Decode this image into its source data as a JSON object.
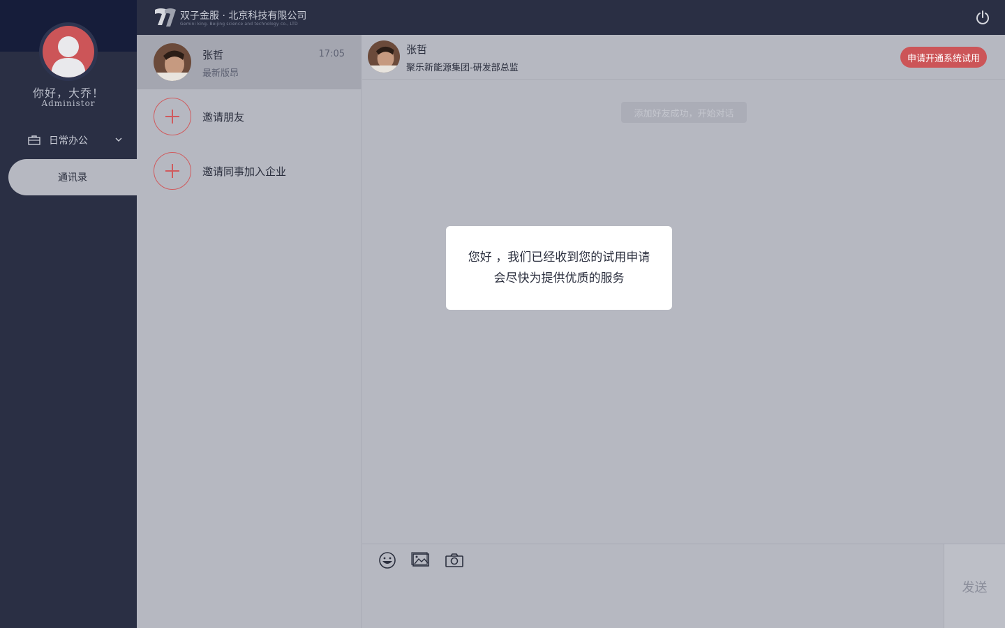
{
  "sidebar": {
    "greeting": "你好，大乔！",
    "role": "Administor",
    "nav_group": {
      "label": "日常办公",
      "icon": "briefcase-icon"
    },
    "nav_items": [
      {
        "label": "通讯录",
        "active": true
      }
    ]
  },
  "header": {
    "brand": "双子金服 · 北京科技有限公司",
    "brand_sub": "Gemini king. Beijing science and technology co., LTD",
    "power_icon": "power-icon"
  },
  "conversations": [
    {
      "name": "张哲",
      "time": "17:05",
      "last_message": "最新版昂",
      "active": true
    }
  ],
  "invites": [
    {
      "label": "邀请朋友",
      "icon": "plus-circle-icon"
    },
    {
      "label": "邀请同事加入企业",
      "icon": "plus-circle-icon"
    }
  ],
  "chat": {
    "name": "张哲",
    "org": "聚乐新能源集团-研发部总监",
    "trial_button": "申请开通系统试用",
    "system_message": "添加好友成功，开始对话"
  },
  "modal": {
    "line1": "您好 ，我们已经收到您的试用申请",
    "line2": "会尽快为提供优质的服务"
  },
  "composer": {
    "tools": [
      "emoji-icon",
      "image-icon",
      "camera-icon"
    ],
    "send_label": "发送"
  },
  "colors": {
    "sidebar_bg": "#2a2f44",
    "content_bg": "#b6b8c1",
    "accent_red": "#cc5558"
  }
}
